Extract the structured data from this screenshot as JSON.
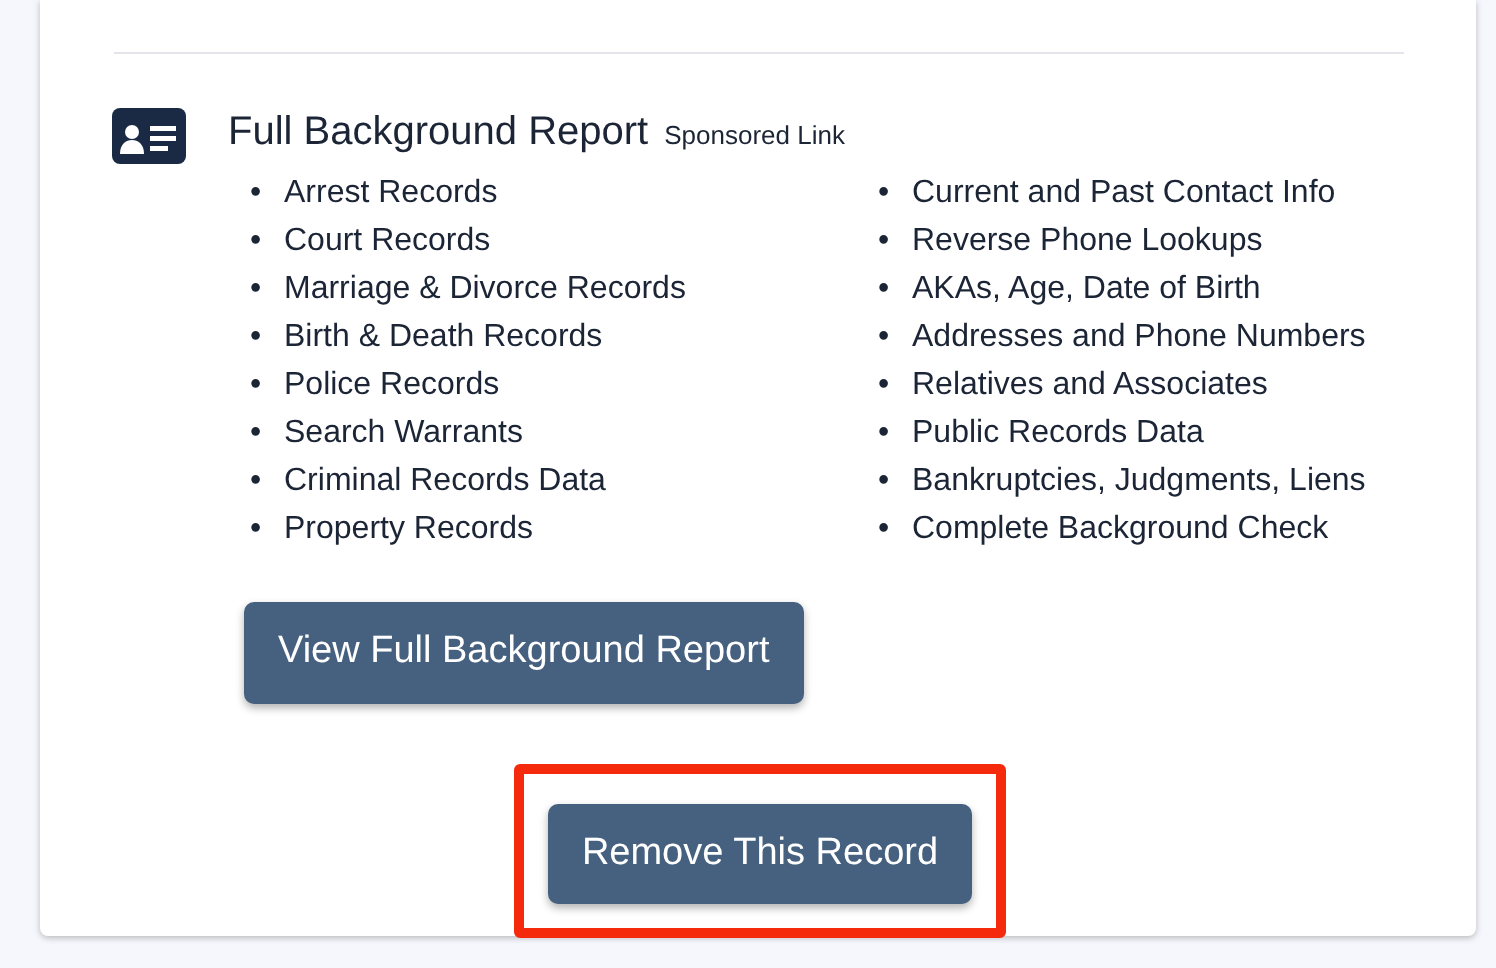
{
  "report": {
    "title": "Full Background Report",
    "tag": "Sponsored Link",
    "marker": "•",
    "columns": [
      [
        "Arrest Records",
        "Court Records",
        "Marriage & Divorce Records",
        "Birth & Death Records",
        "Police Records",
        "Search Warrants",
        "Criminal Records Data",
        "Property Records"
      ],
      [
        "Current and Past Contact Info",
        "Reverse Phone Lookups",
        "AKAs, Age, Date of Birth",
        "Addresses and Phone Numbers",
        "Relatives and Associates",
        "Public Records Data",
        "Bankruptcies, Judgments, Liens",
        "Complete Background Check"
      ]
    ],
    "button": {
      "label": "View Full Background Report"
    }
  },
  "remove_button": {
    "label": "Remove This Record",
    "highlighted": true
  }
}
